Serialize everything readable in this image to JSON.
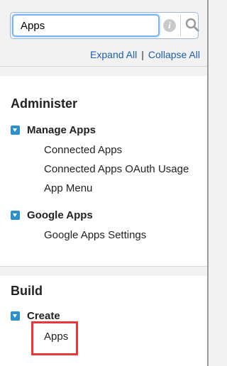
{
  "search": {
    "value": "Apps",
    "info_icon": "info-icon",
    "search_icon": "search-icon"
  },
  "links": {
    "expand_all": "Expand All",
    "separator": "|",
    "collapse_all": "Collapse All"
  },
  "sections": [
    {
      "title": "Administer",
      "groups": [
        {
          "label": "Manage Apps",
          "items": [
            "Connected Apps",
            "Connected Apps OAuth Usage",
            "App Menu"
          ]
        },
        {
          "label": "Google Apps",
          "items": [
            "Google Apps Settings"
          ]
        }
      ]
    },
    {
      "title": "Build",
      "groups": [
        {
          "label": "Create",
          "items": [
            "Apps"
          ]
        }
      ]
    }
  ],
  "colors": {
    "link": "#1f5ea8",
    "toggle": "#2d8fc9",
    "highlight": "#e8383a"
  }
}
